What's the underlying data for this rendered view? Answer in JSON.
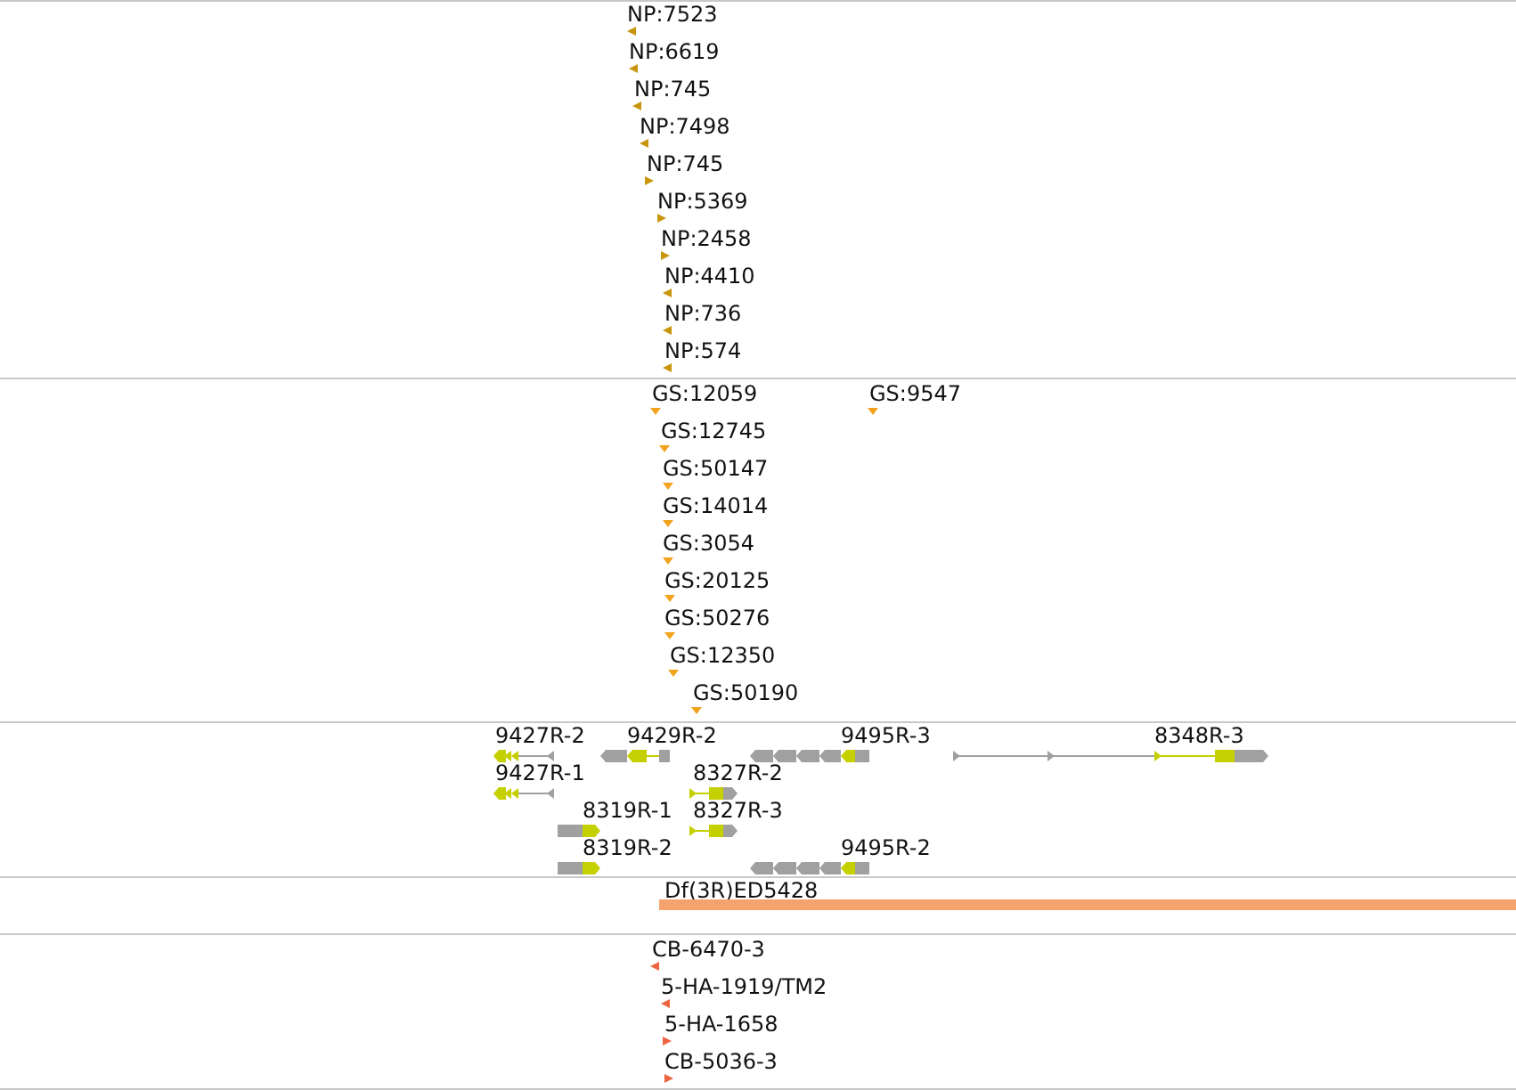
{
  "tracks": [
    {
      "kind": "stranded-markers",
      "color": "#c8960c",
      "features": [
        {
          "label": "NP:7523",
          "reverse": true
        },
        {
          "label": "NP:6619",
          "reverse": true
        },
        {
          "label": "NP:745",
          "reverse": true
        },
        {
          "label": "NP:7498",
          "reverse": true
        },
        {
          "label": "NP:745",
          "reverse": false
        },
        {
          "label": "NP:5369",
          "reverse": false
        },
        {
          "label": "NP:2458",
          "reverse": false
        },
        {
          "label": "NP:4410",
          "reverse": true
        },
        {
          "label": "NP:736",
          "reverse": true
        },
        {
          "label": "NP:574",
          "reverse": true
        }
      ]
    },
    {
      "kind": "markers",
      "color": "#f2a31e",
      "features": [
        {
          "label": "GS:12059"
        },
        {
          "label": "GS:9547"
        },
        {
          "label": "GS:12745"
        },
        {
          "label": "GS:50147"
        },
        {
          "label": "GS:14014"
        },
        {
          "label": "GS:3054"
        },
        {
          "label": "GS:20125"
        },
        {
          "label": "GS:50276"
        },
        {
          "label": "GS:12350"
        },
        {
          "label": "GS:50190"
        }
      ]
    },
    {
      "kind": "transcripts",
      "features": [
        {
          "label": "9427R-2",
          "reverse": true
        },
        {
          "label": "9429R-2",
          "reverse": true
        },
        {
          "label": "9495R-3",
          "reverse": true
        },
        {
          "label": "8348R-3",
          "reverse": false
        },
        {
          "label": "9427R-1",
          "reverse": true
        },
        {
          "label": "8327R-2",
          "reverse": false
        },
        {
          "label": "8319R-1",
          "reverse": false
        },
        {
          "label": "8327R-3",
          "reverse": false
        },
        {
          "label": "8319R-2",
          "reverse": false
        },
        {
          "label": "9495R-2",
          "reverse": true
        }
      ]
    },
    {
      "kind": "span",
      "color": "#f5a36c",
      "features": [
        {
          "label": "Df(3R)ED5428"
        }
      ]
    },
    {
      "kind": "stranded-markers",
      "color": "#ef6440",
      "features": [
        {
          "label": "CB-6470-3",
          "reverse": true
        },
        {
          "label": "5-HA-1919/TM2",
          "reverse": true
        },
        {
          "label": "5-HA-1658",
          "reverse": false
        },
        {
          "label": "CB-5036-3",
          "reverse": false
        }
      ]
    }
  ]
}
